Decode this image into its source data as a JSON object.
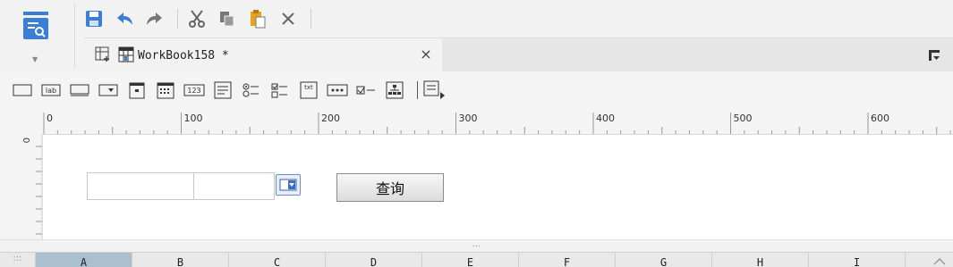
{
  "accent_color": "#3a7fd5",
  "quickbar": {
    "items": [
      {
        "name": "save-icon"
      },
      {
        "name": "undo-icon"
      },
      {
        "name": "redo-icon"
      },
      {
        "name": "cut-icon"
      },
      {
        "name": "copy-icon"
      },
      {
        "name": "paste-icon"
      },
      {
        "name": "delete-icon"
      }
    ]
  },
  "tabs": [
    {
      "title": "WorkBook158 *",
      "close_label": "×"
    }
  ],
  "widget_toolbar": {
    "items": [
      "label-widget-icon",
      "lab-text",
      "text-field-icon",
      "dropdown-icon",
      "date-icon",
      "calendar-icon",
      "number-icon",
      "textarea-icon",
      "radio-group-icon",
      "checkbox-group-icon",
      "txt-icon",
      "password-icon",
      "checkbox-icon",
      "tree-icon",
      "more-icon"
    ],
    "lab_text": "lab",
    "num_text": "123",
    "txt_text": "txt"
  },
  "ruler": {
    "labels": [
      "0",
      "100",
      "200",
      "300",
      "400",
      "500",
      "600"
    ],
    "vertical_label": "0"
  },
  "form": {
    "query_button_label": "查询"
  },
  "splitter": {
    "handle": "..."
  },
  "sheet": {
    "corner": ":::",
    "columns": [
      "A",
      "B",
      "C",
      "D",
      "E",
      "F",
      "G",
      "H",
      "I"
    ],
    "selected_column": "A"
  }
}
